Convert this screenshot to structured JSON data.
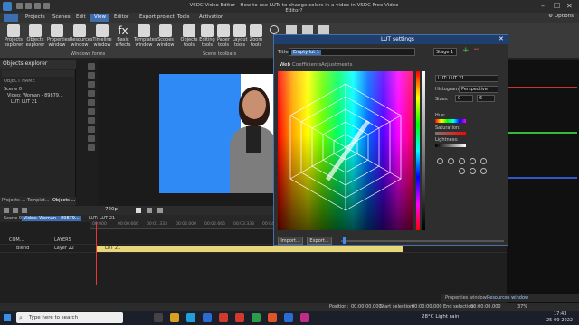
{
  "window": {
    "title": "VSDC Video Editor - How to use LUTs to change colors in a video in VSDC Free Video Editor?"
  },
  "menu": {
    "items": [
      "Projects",
      "Scenes",
      "Edit",
      "View",
      "Editor",
      "Export project",
      "Tools",
      "Activation"
    ],
    "active": "View",
    "options": "Options"
  },
  "ribbon": {
    "buttons": [
      {
        "label": "Projects explorer"
      },
      {
        "label": "Objects explorer"
      },
      {
        "label": "Properties window"
      },
      {
        "label": "Resources window"
      },
      {
        "label": "Timeline window"
      },
      {
        "label": "Basic effects"
      },
      {
        "label": "Templates window"
      },
      {
        "label": "Scopes window"
      },
      {
        "label": "Objects tools"
      },
      {
        "label": "Editing tools"
      },
      {
        "label": "Paper tools"
      },
      {
        "label": "Layout tools"
      },
      {
        "label": "Zoom tools"
      }
    ],
    "groups": [
      "Windows forms",
      "Scene toolbars"
    ]
  },
  "objects_explorer": {
    "title": "Objects explorer",
    "column": "OBJECT NAME",
    "tree": [
      "Scene 0",
      "Video: Woman - 89879...",
      "LUT: LUT 21"
    ],
    "tabs": [
      "Projects ...",
      "Templat...",
      "Objects ..."
    ]
  },
  "timeline": {
    "zoom": "720p",
    "scene_tabs": [
      "Scene 0",
      "Video: Woman - 89879...",
      "LUT: LUT 21"
    ],
    "layers_label": "LAYERS",
    "com_label": "COM...",
    "blend_label": "Blend",
    "layer_name": "Layer 22",
    "clip_label": "LUT 21",
    "ruler": [
      "00:000",
      "00:00.666",
      "00:01.333",
      "00:02.000",
      "00:02.666",
      "00:03.333",
      "00:04.000",
      "00:04.666",
      "00:05.333",
      "00:06.000",
      "00:06.666"
    ]
  },
  "lut_dialog": {
    "title": "LUT settings",
    "title_label": "Title:",
    "name_value": "Empty lut 1",
    "stage": "Stage 1",
    "tabs": [
      "Web",
      "Coefficients",
      "Adjustments"
    ],
    "lut_select": "LUT: LUT 21",
    "histogram_label": "Histogram:",
    "histogram_value": "Perspective",
    "sizes_label": "Sizes:",
    "size_a": "0",
    "size_b": "6",
    "hue_label": "Hue:",
    "saturation_label": "Saturation:",
    "lightness_label": "Lightness:",
    "import_label": "Import...",
    "export_label": "Export..."
  },
  "panels": {
    "properties_tab": "Properties window",
    "resources_tab": "Resources window"
  },
  "status": {
    "position": "Position:",
    "position_val": "00:00:00.000",
    "start_sel": "Start selection:",
    "start_val": "00:00:00.000",
    "end_sel": "End selection:",
    "end_val": "00:00:00.000",
    "zoom": "37%"
  },
  "taskbar": {
    "search_placeholder": "Type here to search",
    "weather": "28°C  Light rain",
    "time": "17:43",
    "date": "25-09-2022"
  },
  "colors": {
    "accent": "#3d6fb0",
    "chroma": "#2f8af5",
    "clip": "#e8d77a"
  }
}
